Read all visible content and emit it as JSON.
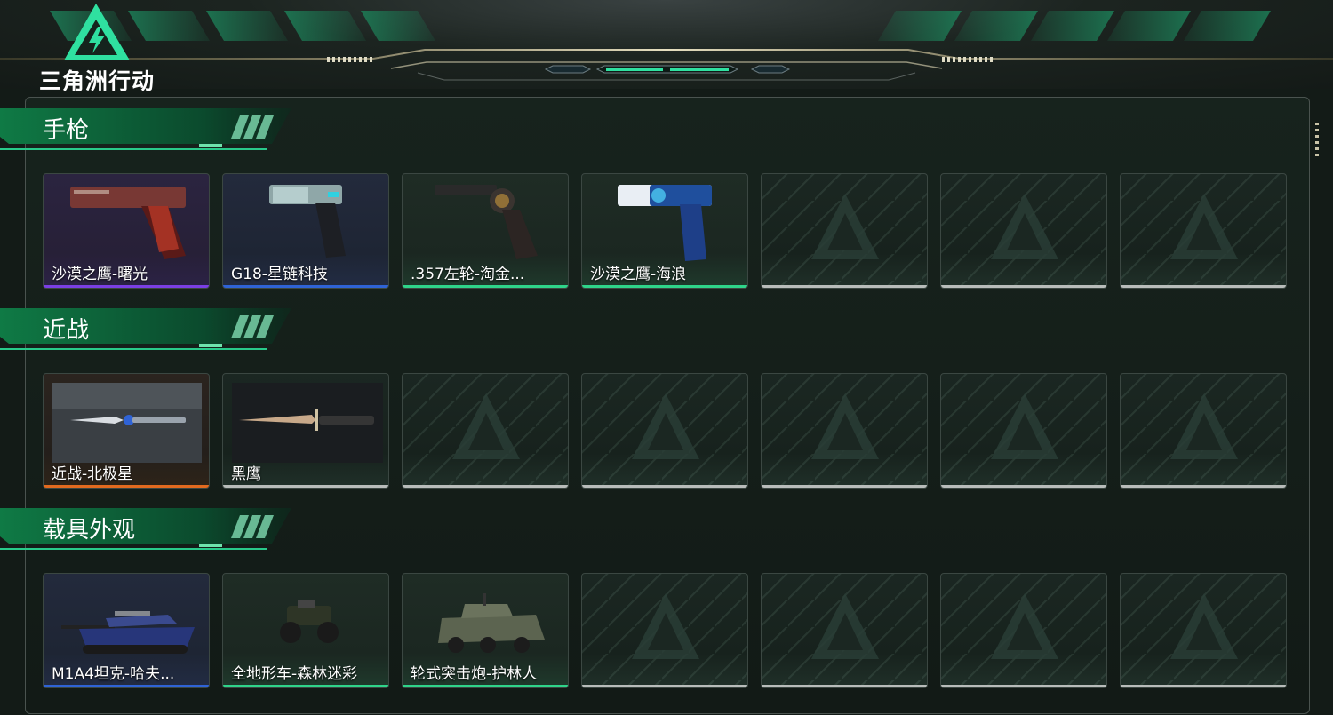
{
  "app": {
    "logo_text": "三角洲行动"
  },
  "colors": {
    "purple": "#7b3fe4",
    "blue": "#2f63d6",
    "green": "#2fd48a",
    "orange": "#e26a1f",
    "empty": "#b8bcba",
    "accent": "#1fd99a"
  },
  "sections": [
    {
      "title": "手枪",
      "items": [
        {
          "name": "沙漠之鹰-曙光",
          "rarity": "purple",
          "icon": "desert-eagle-dawn-icon"
        },
        {
          "name": "G18-星链科技",
          "rarity": "blue",
          "icon": "g18-starlink-icon"
        },
        {
          "name": ".357左轮-淘金...",
          "rarity": "green",
          "icon": "revolver-357-icon"
        },
        {
          "name": "沙漠之鹰-海浪",
          "rarity": "green",
          "icon": "desert-eagle-wave-icon"
        }
      ]
    },
    {
      "title": "近战",
      "items": [
        {
          "name": "近战-北极星",
          "rarity": "orange",
          "icon": "polaris-knife-icon"
        },
        {
          "name": "黑鹰",
          "rarity": "empty",
          "icon": "black-hawk-knife-icon"
        }
      ]
    },
    {
      "title": "载具外观",
      "items": [
        {
          "name": "M1A4坦克-哈夫...",
          "rarity": "blue",
          "icon": "m1a4-tank-icon"
        },
        {
          "name": "全地形车-森林迷彩",
          "rarity": "green",
          "icon": "atv-forest-camo-icon"
        },
        {
          "name": "轮式突击炮-护林人",
          "rarity": "green",
          "icon": "wheeled-assault-gun-icon"
        }
      ]
    }
  ]
}
